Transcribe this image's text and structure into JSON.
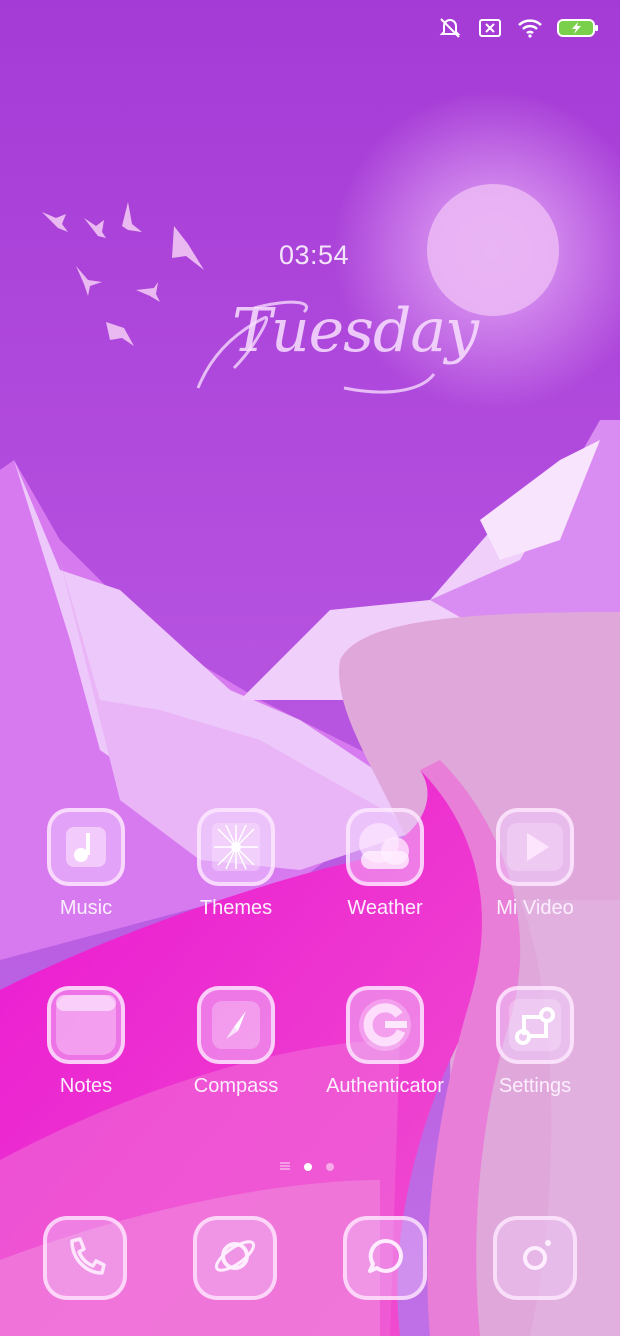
{
  "status_bar": {
    "icons": [
      "mute-vibrate-icon",
      "no-sim-icon",
      "wifi-icon",
      "battery-charging-icon"
    ],
    "battery_color": "#7ad04a"
  },
  "lock_widget": {
    "time": "03:54",
    "day": "Tuesday"
  },
  "apps": [
    {
      "label": "Music",
      "icon": "music-note-icon"
    },
    {
      "label": "Themes",
      "icon": "sparkle-icon"
    },
    {
      "label": "Weather",
      "icon": "cloud-icon"
    },
    {
      "label": "Mi Video",
      "icon": "play-icon"
    },
    {
      "label": "Notes",
      "icon": "notepad-icon"
    },
    {
      "label": "Compass",
      "icon": "compass-icon"
    },
    {
      "label": "Authenticator",
      "icon": "google-g-icon"
    },
    {
      "label": "Settings",
      "icon": "settings-nodes-icon"
    }
  ],
  "page_indicator": {
    "pages": 2,
    "active": 1
  },
  "dock": [
    {
      "icon": "phone-icon"
    },
    {
      "icon": "browser-planet-icon"
    },
    {
      "icon": "messages-icon"
    },
    {
      "icon": "camera-icon"
    }
  ],
  "colors": {
    "sky_top": "#a83cd8",
    "sky_bottom": "#c86ae8",
    "road": "#ee18d6",
    "sand": "#e0a8da",
    "icon_tile": "#f0d2ff"
  }
}
